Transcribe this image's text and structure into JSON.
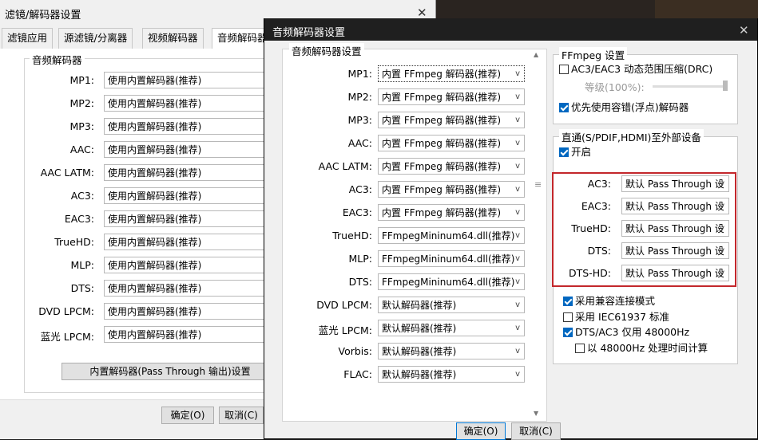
{
  "back_window": {
    "title": "滤镜/解码器设置",
    "tabs": [
      "滤镜应用",
      "源滤镜/分离器",
      "视频解码器",
      "音频解码器"
    ],
    "group_title": "音频解码器",
    "rows": [
      {
        "label": "MP1:",
        "value": "使用内置解码器(推荐)"
      },
      {
        "label": "MP2:",
        "value": "使用内置解码器(推荐)"
      },
      {
        "label": "MP3:",
        "value": "使用内置解码器(推荐)"
      },
      {
        "label": "AAC:",
        "value": "使用内置解码器(推荐)"
      },
      {
        "label": "AAC LATM:",
        "value": "使用内置解码器(推荐)"
      },
      {
        "label": "AC3:",
        "value": "使用内置解码器(推荐)"
      },
      {
        "label": "EAC3:",
        "value": "使用内置解码器(推荐)"
      },
      {
        "label": "TrueHD:",
        "value": "使用内置解码器(推荐)"
      },
      {
        "label": "MLP:",
        "value": "使用内置解码器(推荐)"
      },
      {
        "label": "DTS:",
        "value": "使用内置解码器(推荐)"
      },
      {
        "label": "DVD LPCM:",
        "value": "使用内置解码器(推荐)"
      },
      {
        "label": "蓝光 LPCM:",
        "value": "使用内置解码器(推荐)"
      }
    ],
    "passthrough_button": "内置解码器(Pass Through 输出)设置",
    "ok_button": "确定(O)",
    "cancel_button": "取消(C)"
  },
  "front_window": {
    "title": "音频解码器设置",
    "left_group_title": "音频解码器设置",
    "rows": [
      {
        "label": "MP1:",
        "value": "内置 FFmpeg 解码器(推荐)"
      },
      {
        "label": "MP2:",
        "value": "内置 FFmpeg 解码器(推荐)"
      },
      {
        "label": "MP3:",
        "value": "内置 FFmpeg 解码器(推荐)"
      },
      {
        "label": "AAC:",
        "value": "内置 FFmpeg 解码器(推荐)"
      },
      {
        "label": "AAC LATM:",
        "value": "内置 FFmpeg 解码器(推荐)"
      },
      {
        "label": "AC3:",
        "value": "内置 FFmpeg 解码器(推荐)"
      },
      {
        "label": "EAC3:",
        "value": "内置 FFmpeg 解码器(推荐)"
      },
      {
        "label": "TrueHD:",
        "value": "FFmpegMininum64.dll(推荐)"
      },
      {
        "label": "MLP:",
        "value": "FFmpegMininum64.dll(推荐)"
      },
      {
        "label": "DTS:",
        "value": "FFmpegMininum64.dll(推荐)"
      },
      {
        "label": "DVD LPCM:",
        "value": "默认解码器(推荐)"
      },
      {
        "label": "蓝光 LPCM:",
        "value": "默认解码器(推荐)"
      },
      {
        "label": "Vorbis:",
        "value": "默认解码器(推荐)"
      },
      {
        "label": "FLAC:",
        "value": "默认解码器(推荐)"
      }
    ],
    "ffmpeg_group": {
      "title": "FFmpeg 设置",
      "drc_label": "AC3/EAC3 动态范围压缩(DRC)",
      "drc_checked": false,
      "level_label": "等级(100%):",
      "level_fraction": 1.0,
      "float_label": "优先使用容错(浮点)解码器",
      "float_checked": true
    },
    "passthrough_group": {
      "title": "直通(S/PDIF,HDMI)至外部设备",
      "enable_label": "开启",
      "enable_checked": true,
      "rows": [
        {
          "label": "AC3:",
          "value": "默认 Pass Through 设"
        },
        {
          "label": "EAC3:",
          "value": "默认 Pass Through 设"
        },
        {
          "label": "TrueHD:",
          "value": "默认 Pass Through 设"
        },
        {
          "label": "DTS:",
          "value": "默认 Pass Through 设"
        },
        {
          "label": "DTS-HD:",
          "value": "默认 Pass Through 设"
        }
      ],
      "compat_label": "采用兼容连接模式",
      "compat_checked": true,
      "iec_label": "采用 IEC61937 标准",
      "iec_checked": false,
      "dts48_label": "DTS/AC3 仅用 48000Hz",
      "dts48_checked": true,
      "time48_label": "以 48000Hz 处理时间计算",
      "time48_checked": false
    },
    "ok_button": "确定(O)",
    "cancel_button": "取消(C)"
  },
  "colors": {
    "accent": "#0067c0",
    "highlight_border": "#c3272b",
    "dark_title": "#1f1f1f"
  }
}
